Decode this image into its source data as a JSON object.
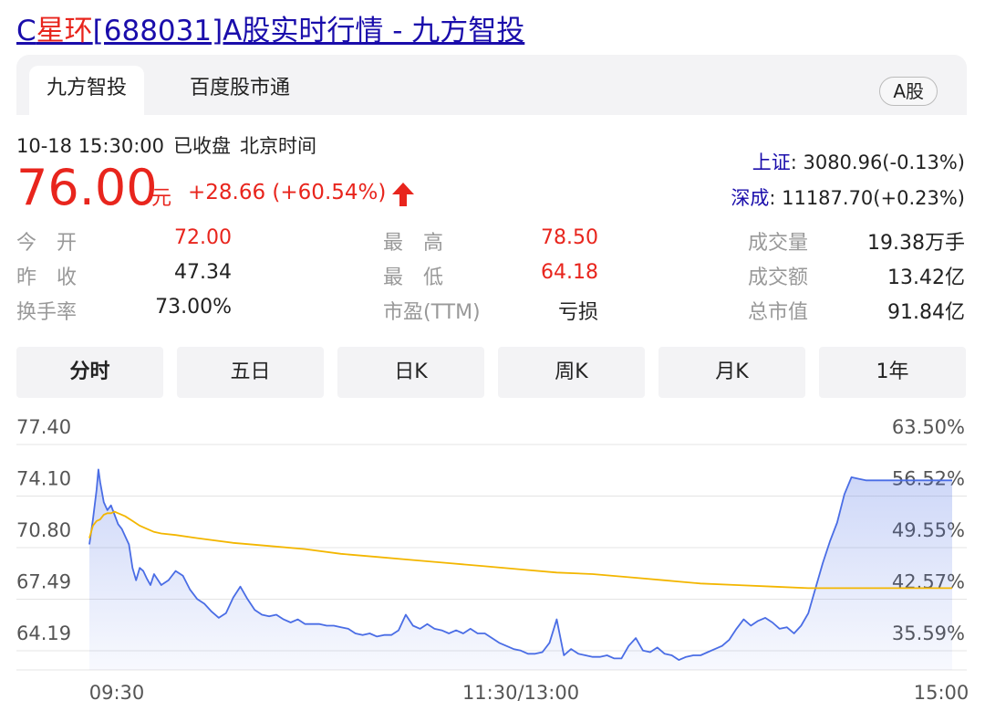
{
  "title": {
    "prefix": "C",
    "highlight": "星环",
    "rest": "[688031]A股实时行情 - 九方智投"
  },
  "tabs": [
    {
      "label": "九方智投",
      "active": true
    },
    {
      "label": "百度股市通",
      "active": false
    }
  ],
  "tag": "A股",
  "meta": {
    "datetime": "10-18 15:30:00",
    "status": "已收盘",
    "tz": "北京时间"
  },
  "quote": {
    "price": "76.00",
    "unit": "元",
    "change": "+28.66 (+60.54%)",
    "direction": "up"
  },
  "indices": [
    {
      "name": "上证",
      "value": ": 3080.96(-0.13%)"
    },
    {
      "name": "深成",
      "value": ": 11187.70(+0.23%)"
    }
  ],
  "stats": {
    "open": {
      "label": "今　开",
      "value": "72.00"
    },
    "high": {
      "label": "最　高",
      "value": "78.50"
    },
    "volume": {
      "label": "成交量",
      "value": "19.38万手"
    },
    "prev_close": {
      "label": "昨　收",
      "value": "47.34"
    },
    "low": {
      "label": "最　低",
      "value": "64.18"
    },
    "turnover_amt": {
      "label": "成交额",
      "value": "13.42亿"
    },
    "turnover_rate": {
      "label": "换手率",
      "value": "73.00%"
    },
    "pe": {
      "label": "市盈(TTM)",
      "value": "亏损"
    },
    "market_cap": {
      "label": "总市值",
      "value": "91.84亿"
    }
  },
  "period_tabs": [
    {
      "label": "分时",
      "active": true
    },
    {
      "label": "五日",
      "active": false
    },
    {
      "label": "日K",
      "active": false
    },
    {
      "label": "周K",
      "active": false
    },
    {
      "label": "月K",
      "active": false
    },
    {
      "label": "1年",
      "active": false
    }
  ],
  "colors": {
    "up": "#e8251d",
    "link": "#1a0dab",
    "price_line": "#4a6de5",
    "avg_line": "#f3b600",
    "tab_bg": "#f3f3f5"
  },
  "chart_data": {
    "type": "line",
    "y_left_ticks": [
      "77.40",
      "74.10",
      "70.80",
      "67.49",
      "64.19"
    ],
    "y_right_ticks": [
      "63.50%",
      "56.52%",
      "49.55%",
      "42.57%",
      "35.59%"
    ],
    "ylim": [
      64.19,
      77.4
    ],
    "x_ticks": [
      "09:30",
      "11:30/13:00",
      "15:00"
    ],
    "x_tick_positions": [
      0,
      120,
      240
    ],
    "xlim": [
      0,
      240
    ],
    "series": [
      {
        "role": "price",
        "x": [
          0,
          1,
          2,
          2.5,
          3,
          4,
          5,
          6,
          7,
          8,
          9,
          10,
          11,
          12,
          13,
          14,
          15,
          16,
          17,
          18,
          20,
          22,
          24,
          26,
          28,
          30,
          32,
          34,
          36,
          38,
          40,
          42,
          44,
          46,
          48,
          50,
          52,
          54,
          56,
          58,
          60,
          62,
          64,
          66,
          68,
          70,
          72,
          74,
          76,
          78,
          80,
          82,
          84,
          86,
          88,
          90,
          92,
          94,
          96,
          98,
          100,
          102,
          104,
          106,
          108,
          110,
          112,
          114,
          116,
          118,
          120,
          122,
          124,
          126,
          128,
          130,
          132,
          134,
          136,
          138,
          140,
          142,
          144,
          146,
          148,
          150,
          152,
          154,
          156,
          158,
          160,
          162,
          164,
          166,
          168,
          170,
          172,
          174,
          176,
          178,
          180,
          182,
          184,
          186,
          188,
          190,
          192,
          194,
          196,
          198,
          200,
          202,
          204,
          206,
          208,
          210,
          212,
          214,
          216,
          218,
          220,
          222,
          224,
          226,
          228,
          230,
          232,
          234,
          236,
          238,
          240
        ],
        "y": [
          71.0,
          72.6,
          74.5,
          75.8,
          75.0,
          73.7,
          73.2,
          73.5,
          72.9,
          72.3,
          72.0,
          71.5,
          71.0,
          69.5,
          68.7,
          69.5,
          69.3,
          68.8,
          68.4,
          69.1,
          68.4,
          68.7,
          69.3,
          69.0,
          68.1,
          67.5,
          67.2,
          66.7,
          66.3,
          66.6,
          67.6,
          68.3,
          67.5,
          66.8,
          66.5,
          66.4,
          66.5,
          66.2,
          66.0,
          66.2,
          65.9,
          65.9,
          65.9,
          65.8,
          65.8,
          65.7,
          65.6,
          65.3,
          65.2,
          65.3,
          65.1,
          65.2,
          65.2,
          65.5,
          66.5,
          65.8,
          65.6,
          65.9,
          65.6,
          65.5,
          65.3,
          65.5,
          65.3,
          65.6,
          65.3,
          65.3,
          65.0,
          64.7,
          64.5,
          64.3,
          64.2,
          64.0,
          64.0,
          64.1,
          64.7,
          66.2,
          63.9,
          64.3,
          64.0,
          63.9,
          63.8,
          63.8,
          63.9,
          63.7,
          63.7,
          64.5,
          65.0,
          64.2,
          64.1,
          64.4,
          64.0,
          63.9,
          63.6,
          63.8,
          63.9,
          63.9,
          64.1,
          64.3,
          64.5,
          64.9,
          65.6,
          66.2,
          65.8,
          66.1,
          66.3,
          66.0,
          65.6,
          65.7,
          65.3,
          65.8,
          66.6,
          68.2,
          69.8,
          71.2,
          72.4,
          74.2,
          75.3,
          75.2,
          75.1,
          75.1,
          75.1,
          75.1,
          75.1,
          75.1,
          75.1,
          75.1,
          75.1,
          75.1,
          75.1,
          75.1,
          75.1
        ]
      },
      {
        "role": "average",
        "x": [
          0,
          1,
          2,
          3,
          4,
          5,
          6,
          7,
          8,
          10,
          12,
          14,
          16,
          18,
          20,
          24,
          30,
          40,
          50,
          60,
          70,
          80,
          90,
          100,
          110,
          120,
          130,
          140,
          150,
          160,
          170,
          180,
          190,
          200,
          210,
          220,
          230,
          240
        ],
        "y": [
          71.4,
          72.2,
          72.5,
          72.6,
          72.9,
          73.0,
          73.0,
          73.1,
          73.0,
          72.8,
          72.5,
          72.2,
          72.0,
          71.8,
          71.7,
          71.6,
          71.4,
          71.1,
          70.9,
          70.7,
          70.4,
          70.2,
          70.0,
          69.8,
          69.6,
          69.4,
          69.2,
          69.1,
          68.9,
          68.7,
          68.5,
          68.4,
          68.3,
          68.2,
          68.2,
          68.2,
          68.2,
          68.2
        ]
      }
    ]
  }
}
